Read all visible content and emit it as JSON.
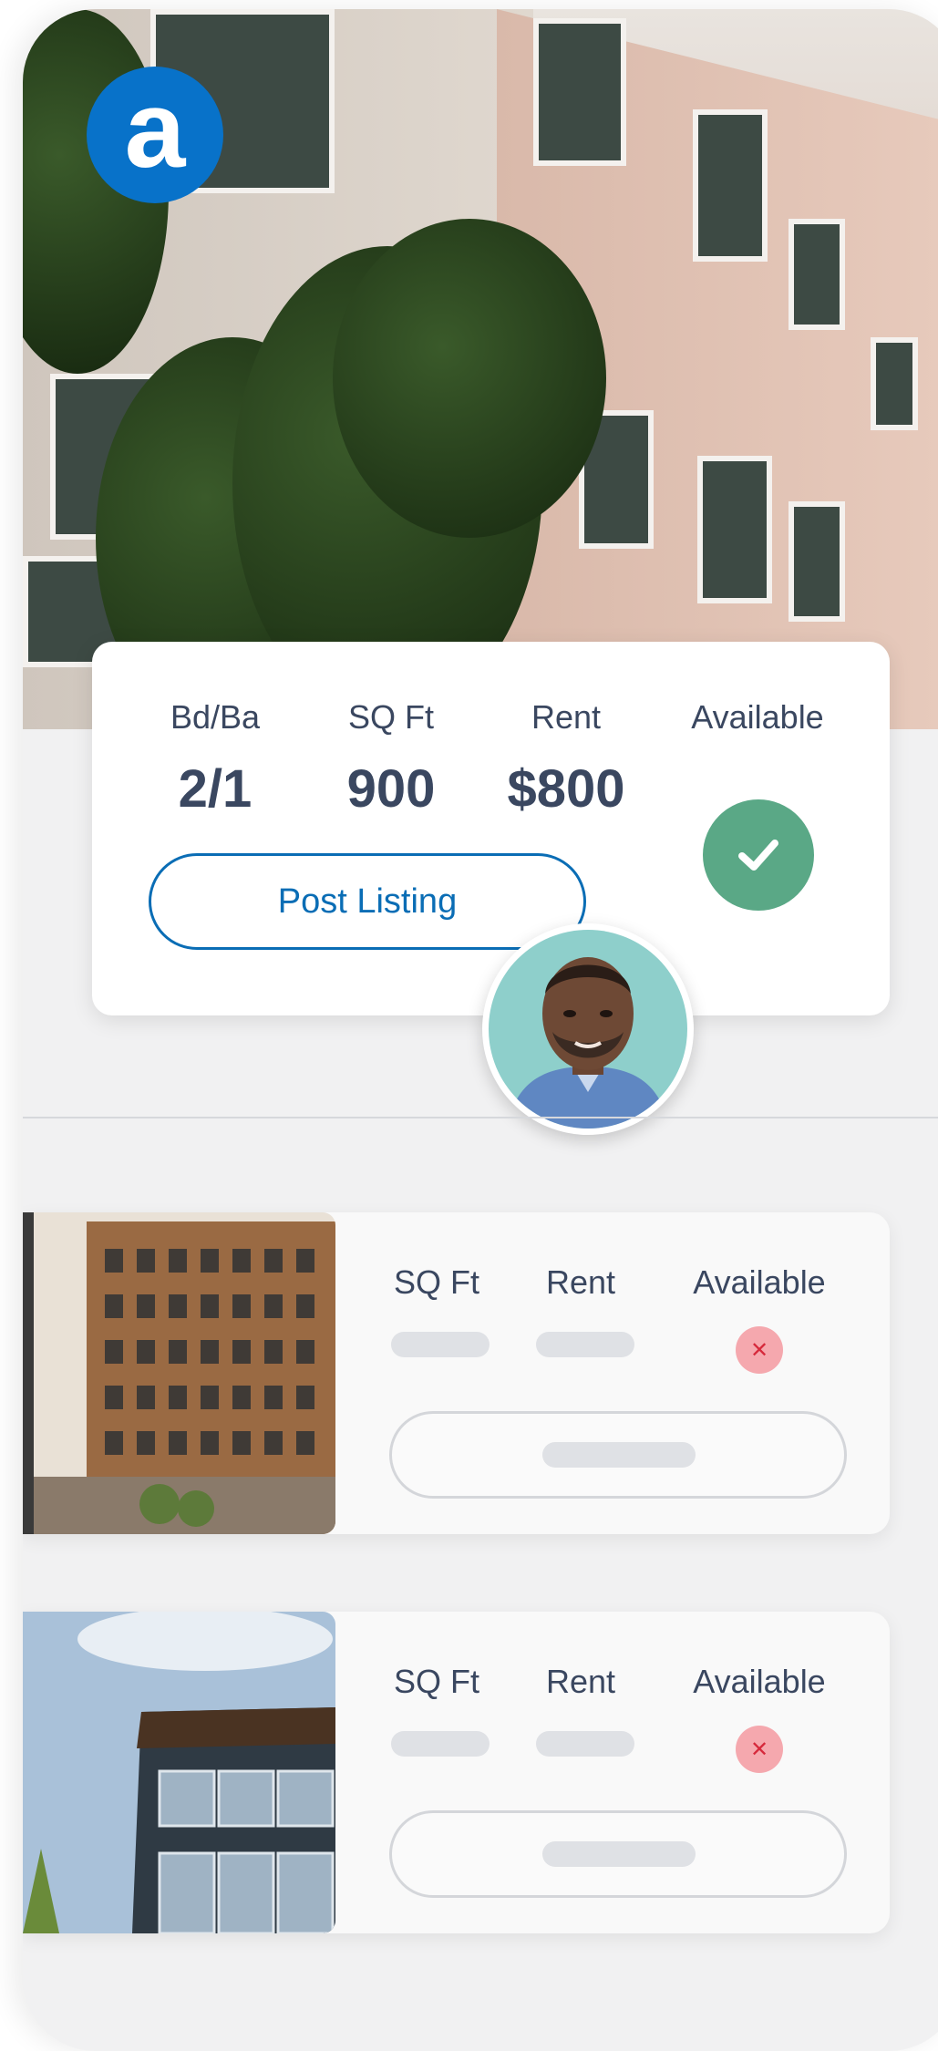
{
  "brand": {
    "logo_letter": "a",
    "accent": "#0872c9"
  },
  "featured": {
    "stats": [
      {
        "label": "Bd/Ba",
        "value": "2/1"
      },
      {
        "label": "SQ Ft",
        "value": "900"
      },
      {
        "label": "Rent",
        "value": "$800"
      }
    ],
    "available_label": "Available",
    "available": true,
    "post_button_label": "Post Listing",
    "check_icon": "check-icon",
    "check_color": "#5aa886"
  },
  "listings": [
    {
      "labels": {
        "sqft": "SQ Ft",
        "rent": "Rent",
        "available": "Available"
      },
      "available": false,
      "status_icon": "close-icon"
    },
    {
      "labels": {
        "sqft": "SQ Ft",
        "rent": "Rent",
        "available": "Available"
      },
      "available": false,
      "status_icon": "close-icon"
    }
  ],
  "colors": {
    "text": "#3a4760",
    "unavailable": "#f5a8ae",
    "unavailable_x": "#d6293b"
  }
}
